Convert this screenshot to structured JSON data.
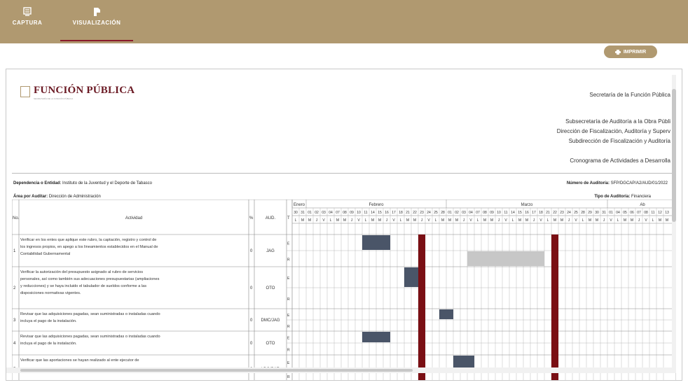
{
  "tabs": [
    {
      "label": "CAPTURA",
      "icon": "form-icon"
    },
    {
      "label": "VISUALIZACIÓN",
      "icon": "document-icon",
      "active": true
    }
  ],
  "toolbar": {
    "print_label": "IMPRIMIR"
  },
  "header": {
    "logo_title": "FUNCIÓN PÚBLICA",
    "logo_subtitle": "SECRETARÍA DE LA FUNCIÓN PÚBLICA",
    "org": "Secretaría de la Función Pública",
    "line1": "Subsecretaría de Auditoría a la Obra Públi",
    "line2": "Dirección de Fiscalización, Auditoría y Superv",
    "line3": "Subdirección de Fiscalización y Auditoría",
    "line4": "Cronograma de Actividades a Desarrolla"
  },
  "meta": {
    "dependencia_label": "Dependencia o Entidad:",
    "dependencia_value": "Instituto de la Juventud y el Deporte de Tabasco",
    "area_label": "Área por Auditar:",
    "area_value": "Dirección de Administración",
    "numero_label": "Número de Auditoría:",
    "numero_value": "SFP/DGCAP/A2/AUD/01/2022",
    "tipo_label": "Tipo de Auditoría:",
    "tipo_value": "Financiera"
  },
  "table": {
    "headers": {
      "no": "No.",
      "actividad": "Actividad",
      "pct": "%",
      "aud": "AUD.",
      "t": "T"
    },
    "months": [
      "Enero",
      "Febrero",
      "Marzo",
      "Ab"
    ],
    "days": [
      "30",
      "31",
      "01",
      "02",
      "03",
      "04",
      "07",
      "08",
      "09",
      "10",
      "11",
      "14",
      "15",
      "16",
      "17",
      "18",
      "21",
      "22",
      "23",
      "24",
      "25",
      "28",
      "01",
      "02",
      "03",
      "04",
      "07",
      "08",
      "09",
      "10",
      "11",
      "14",
      "15",
      "16",
      "17",
      "18",
      "21",
      "22",
      "23",
      "24",
      "25",
      "28",
      "29",
      "30",
      "31",
      "01",
      "04",
      "05",
      "06",
      "07",
      "08",
      "11",
      "12",
      "13",
      "14"
    ],
    "weekdays": [
      "L",
      "M",
      "M",
      "J",
      "V",
      "L",
      "M",
      "M",
      "J",
      "V",
      "L",
      "M",
      "M",
      "J",
      "V",
      "L",
      "M",
      "M",
      "J",
      "V",
      "L",
      "M",
      "M",
      "M",
      "J",
      "V",
      "L",
      "M",
      "M",
      "J",
      "V",
      "L",
      "M",
      "M",
      "J",
      "V",
      "L",
      "M",
      "M",
      "J",
      "V",
      "L",
      "M",
      "M",
      "J",
      "V",
      "L",
      "M",
      "M",
      "J",
      "V",
      "L",
      "M",
      "M",
      "J"
    ],
    "rows": [
      {
        "no": "1",
        "actividad_lines": [
          "Verificar en los entes que aplique este rubro, la captación, registro y control de",
          "los ingresos propios, en apego a los lineamientos establecidos en el Manual de",
          "Contabilidad Gubernamental"
        ],
        "pct": "0",
        "aud": "JAG"
      },
      {
        "no": "2",
        "actividad_lines": [
          "Verificar la autorización del presupuesto asignado al rubro de servicios",
          "personales, así como también sus adecuaciones presupuestarias (ampliaciones",
          "y reducciones) y se haya incluido el tabulador de sueldos conforme a las",
          "disposiciones normativas vigentes."
        ],
        "pct": "0",
        "aud": "OTO"
      },
      {
        "no": "3",
        "actividad_lines": [
          "Revisar que las adquisiciones pagadas, sean suministradas o instaladas cuando",
          "incluya el pago de la instalación."
        ],
        "pct": "0",
        "aud": "DMC/JAG"
      },
      {
        "no": "4",
        "actividad_lines": [
          "Revisar que las adquisiciones pagadas, sean suministradas o instaladas cuando",
          "incluya el pago de la instalación."
        ],
        "pct": "0",
        "aud": "OTO"
      },
      {
        "no": "5",
        "actividad_lines": [
          "Verificar que las aportaciones se hayan realizado al ente ejecutor de"
        ],
        "pct": "0",
        "aud": "LDO/BAR"
      }
    ],
    "er_labels": [
      "E",
      "R"
    ],
    "colors": {
      "estimated": "#4a5568",
      "real": "#c7c7c7",
      "deadline": "#7a0f14"
    }
  }
}
